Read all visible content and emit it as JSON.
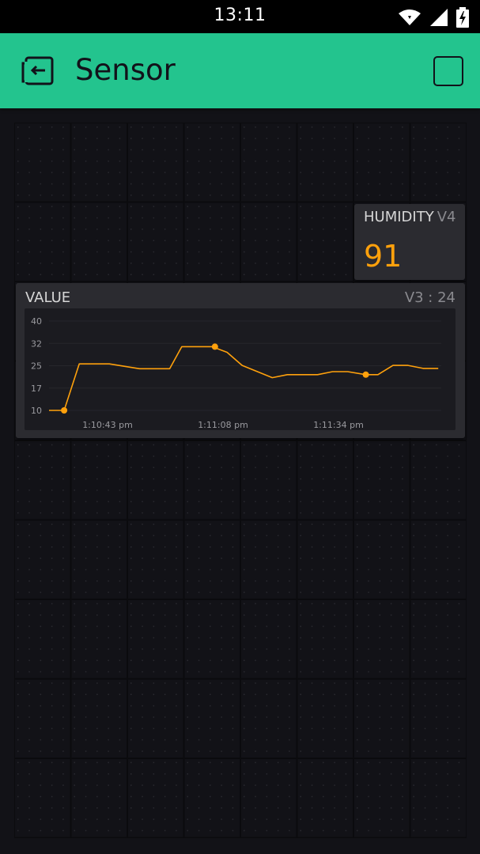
{
  "status_bar": {
    "time": "13:11",
    "icons": [
      "wifi-icon",
      "signal-icon",
      "battery-charging-icon"
    ]
  },
  "app_bar": {
    "title": "Sensor",
    "back_icon": "exit-project-icon",
    "action_icon": "square-icon",
    "color": "#23c48e"
  },
  "widgets": {
    "humidity": {
      "label": "HUMIDITY",
      "pin": "V4",
      "value": "91",
      "color": "#ffa10c"
    },
    "value_chart": {
      "title": "VALUE",
      "pin_readout": "V3 : 24"
    }
  },
  "chart_data": {
    "type": "line",
    "title": "VALUE",
    "yticks": [
      "40",
      "32",
      "25",
      "17",
      "10"
    ],
    "ylim": [
      10,
      40
    ],
    "xticks": [
      "1:10:43 pm",
      "1:11:08 pm",
      "1:11:34 pm"
    ],
    "xlim_seconds": [
      38,
      103
    ],
    "series": [
      {
        "color": "#ffa10c",
        "points": [
          [
            38,
            10
          ],
          [
            40.5,
            10
          ],
          [
            43,
            25.6
          ],
          [
            48,
            25.6
          ],
          [
            53,
            24
          ],
          [
            58,
            24
          ],
          [
            60,
            31.4
          ],
          [
            65,
            31.4
          ],
          [
            67.5,
            29.5
          ],
          [
            70,
            25.1
          ],
          [
            75,
            21
          ],
          [
            77.5,
            22
          ],
          [
            82.5,
            22
          ],
          [
            85,
            23
          ],
          [
            87.5,
            23
          ],
          [
            90.5,
            22
          ],
          [
            92.5,
            22
          ],
          [
            95,
            25.1
          ],
          [
            97.5,
            25.1
          ],
          [
            100,
            24.1
          ],
          [
            102.5,
            24.1
          ]
        ],
        "markers": [
          [
            40.5,
            10
          ],
          [
            65.5,
            31.4
          ],
          [
            90.5,
            22
          ]
        ]
      }
    ],
    "grid": "horizontal"
  }
}
